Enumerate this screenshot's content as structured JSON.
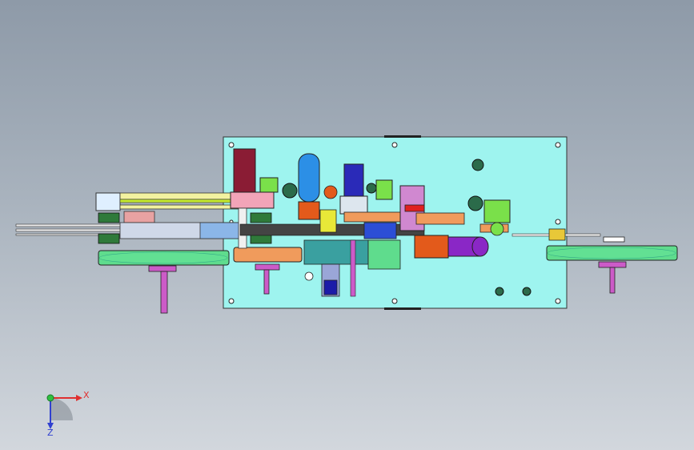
{
  "viewport": {
    "background_top": "#8e9aa8",
    "background_bottom": "#d2d7dd"
  },
  "machine": {
    "base_plate_color": "#9ef4ef",
    "pulley_color": "#5fdc8d",
    "shaft_color": "#cc5bc8",
    "accent_colors": [
      "#e35a1b",
      "#2c8fe6",
      "#f09b5c",
      "#8a27c6",
      "#8a1c34",
      "#7ae04a",
      "#f2f2a0"
    ]
  },
  "triad": {
    "x_label": "X",
    "z_label": "Z",
    "x_color": "#e03030",
    "y_color": "#2ec040",
    "z_color": "#3040d0"
  }
}
